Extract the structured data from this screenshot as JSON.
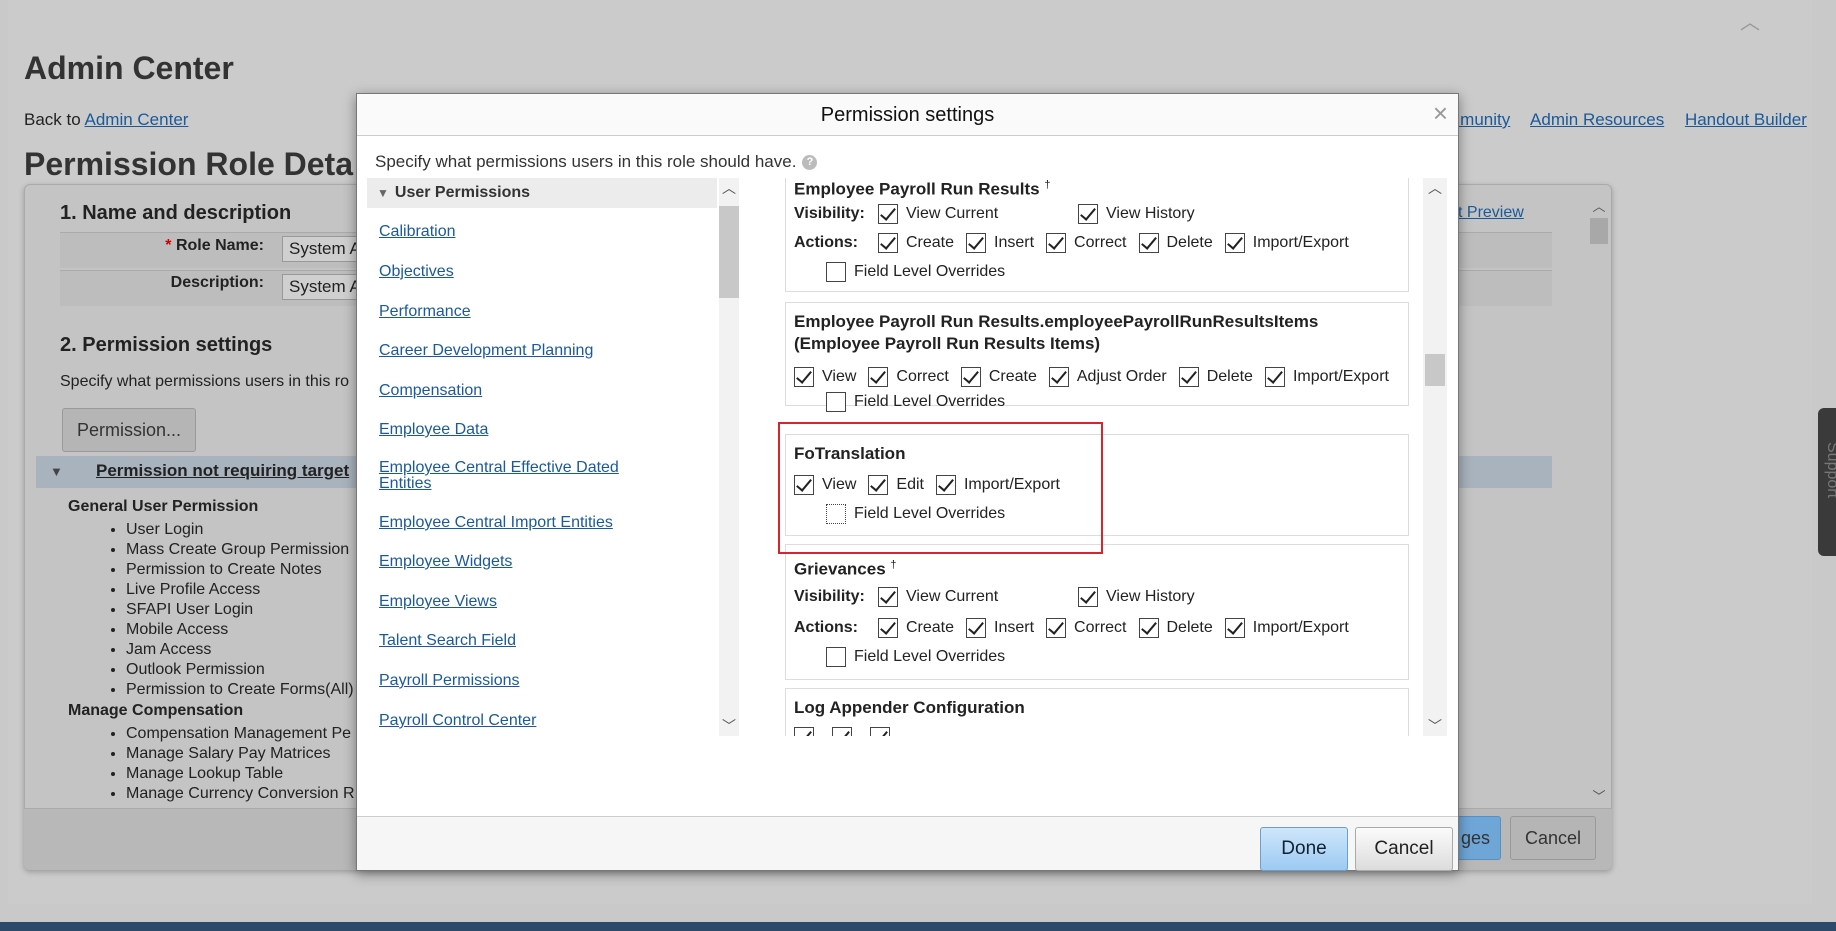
{
  "background": {
    "app_title": "Admin Center",
    "back_prefix": "Back to",
    "back_link": "Admin Center",
    "header_links": [
      "mmunity",
      "Admin Resources",
      "Handout Builder"
    ],
    "page_title": "Permission Role Detai",
    "section1": "1. Name and description",
    "role_name_label": "Role Name:",
    "role_name_value": "System A",
    "description_label": "Description:",
    "description_value": "System A",
    "preview_link": "t Preview",
    "section2": "2. Permission settings",
    "section2_desc": "Specify what permissions users in this ro",
    "permission_button": "Permission...",
    "not_requiring_target": "Permission not requiring target",
    "group_general": "General User Permission",
    "general_items": [
      "User Login",
      "Mass Create Group Permission",
      "Permission to Create Notes",
      "Live Profile Access",
      "SFAPI User Login",
      "Mobile Access",
      "Jam Access",
      "Outlook Permission",
      "Permission to Create Forms(All)"
    ],
    "group_comp": "Manage Compensation",
    "comp_items": [
      "Compensation Management Pe",
      "Manage Salary Pay Matrices",
      "Manage Lookup Table",
      "Manage Currency Conversion R"
    ],
    "save_fragment": "ges",
    "cancel_label": "Cancel",
    "support_label": "Support"
  },
  "modal": {
    "title": "Permission settings",
    "close_glyph": "×",
    "description": "Specify what permissions users in this role should have.",
    "help_glyph": "?",
    "nav_header": "User Permissions",
    "nav_items": [
      "Calibration",
      "Objectives",
      "Performance",
      "Career Development Planning",
      "Compensation",
      "Employee Data",
      "Employee Central Effective Dated Entities",
      "Employee Central Import Entities",
      "Employee Widgets",
      "Employee Views",
      "Talent Search Field",
      "Payroll Permissions",
      "Payroll Control Center"
    ],
    "labels": {
      "visibility": "Visibility:",
      "actions": "Actions:",
      "view_current": "View Current",
      "view_history": "View History",
      "create": "Create",
      "insert": "Insert",
      "correct": "Correct",
      "delete": "Delete",
      "import_export": "Import/Export",
      "field_level_overrides": "Field Level Overrides",
      "view": "View",
      "edit": "Edit",
      "adjust_order": "Adjust Order"
    },
    "sections": [
      {
        "title": "Employee Payroll Run Results",
        "marker": "†"
      },
      {
        "title": "Employee Payroll Run Results.employeePayrollRunResultsItems",
        "subtitle": "(Employee Payroll Run Results Items)"
      },
      {
        "title": "FoTranslation"
      },
      {
        "title": "Grievances",
        "marker": "†"
      },
      {
        "title": "Log Appender Configuration"
      }
    ],
    "done_label": "Done",
    "cancel_label": "Cancel"
  }
}
